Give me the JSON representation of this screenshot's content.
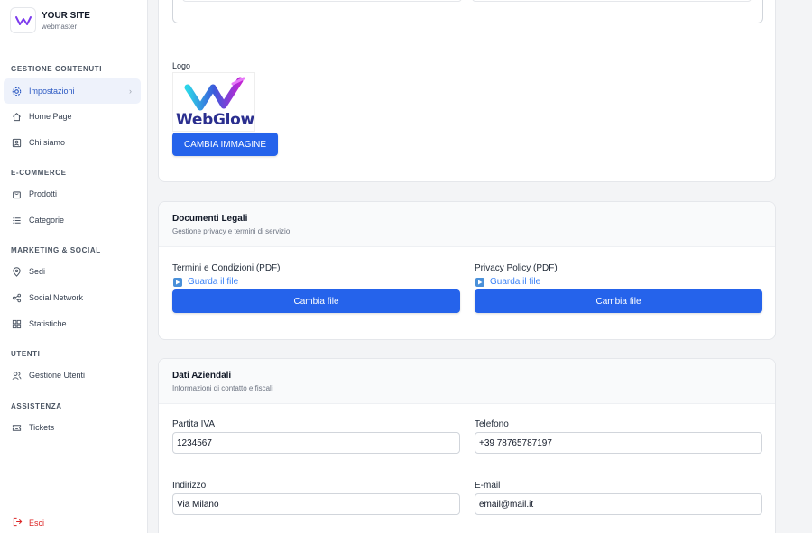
{
  "brand": {
    "title": "YOUR SITE",
    "subtitle": "webmaster"
  },
  "sidebar": {
    "sections": [
      {
        "title": "GESTIONE CONTENUTI"
      },
      {
        "title": "E-COMMERCE"
      },
      {
        "title": "MARKETING & SOCIAL"
      },
      {
        "title": "UTENTI"
      },
      {
        "title": "ASSISTENZA"
      }
    ],
    "items": [
      {
        "label": "Impostazioni",
        "icon": "gear-icon",
        "active": true
      },
      {
        "label": "Home Page",
        "icon": "home-icon"
      },
      {
        "label": "Chi siamo",
        "icon": "id-card-icon"
      },
      {
        "label": "Prodotti",
        "icon": "bag-icon"
      },
      {
        "label": "Categorie",
        "icon": "list-icon"
      },
      {
        "label": "Sedi",
        "icon": "map-pin-icon"
      },
      {
        "label": "Social Network",
        "icon": "share-icon"
      },
      {
        "label": "Statistiche",
        "icon": "grid-icon"
      },
      {
        "label": "Gestione Utenti",
        "icon": "users-icon"
      },
      {
        "label": "Tickets",
        "icon": "ticket-icon"
      }
    ],
    "logout": "Esci"
  },
  "logo_section": {
    "label": "Logo",
    "logo_text": "WebGlow",
    "change_button": "CAMBIA IMMAGINE"
  },
  "legal": {
    "title": "Documenti Legali",
    "subtitle": "Gestione privacy e termini di servizio",
    "terms_label": "Termini e Condizioni (PDF)",
    "terms_link": "Guarda il file",
    "terms_button": "Cambia file",
    "privacy_label": "Privacy Policy (PDF)",
    "privacy_link": "Guarda il file",
    "privacy_button": "Cambia file"
  },
  "company": {
    "title": "Dati Aziendali",
    "subtitle": "Informazioni di contatto e fiscali",
    "vat_label": "Partita IVA",
    "vat_value": "1234567",
    "phone_label": "Telefono",
    "phone_value": "+39 78765787197",
    "address_label": "Indirizzo",
    "address_value": "Via Milano",
    "email_label": "E-mail",
    "email_value": "email@mail.it"
  },
  "colors": {
    "primary": "#2563eb",
    "active_bg": "#eef2fb",
    "danger": "#dc2626"
  }
}
